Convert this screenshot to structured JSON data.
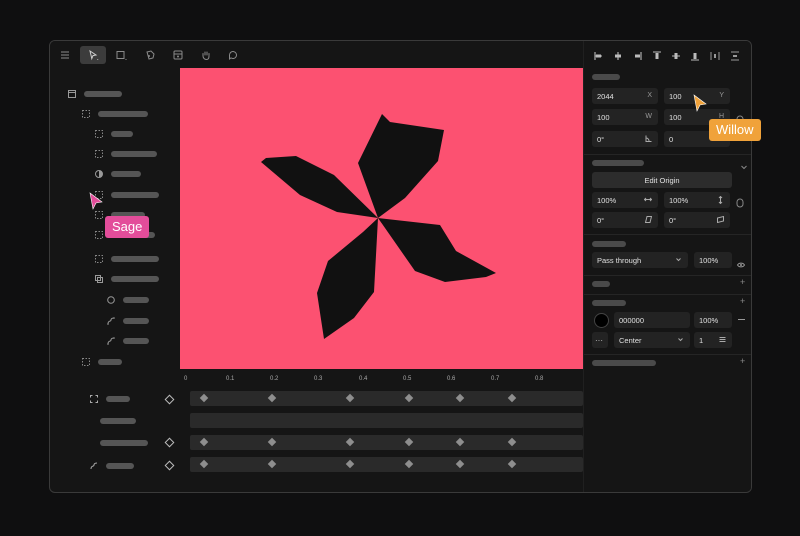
{
  "colors": {
    "canvas_bg": "#fc5171",
    "shape_fill": "#111111",
    "app_bg": "#151515",
    "field_bg": "#232323",
    "sage": "#e34d9a",
    "willow": "#f0a23a"
  },
  "toolbar": {
    "tools": [
      "menu-icon",
      "select-arrow-icon",
      "rectangle-icon",
      "pen-tool-icon",
      "frame-icon",
      "hand-icon",
      "comment-icon"
    ]
  },
  "panel": {
    "x_value": "2044",
    "x_label": "X",
    "y_value": "100",
    "y_label": "Y",
    "w_value": "100",
    "w_label": "W",
    "h_value": "100",
    "h_label": "H",
    "rotation_value": "0°",
    "corner_value": "0",
    "edit_origin_label": "Edit Origin",
    "scale_x": "100%",
    "scale_y": "100%",
    "skew_x": "0°",
    "skew_y": "0°",
    "blend_mode": "Pass through",
    "opacity": "100%",
    "fill_hex": "000000",
    "fill_opacity": "100%",
    "stroke_align": "Center",
    "stroke_width": "1"
  },
  "timeline": {
    "ruler_labels": [
      "0",
      "0.1",
      "0.2",
      "0.3",
      "0.4",
      "0.5",
      "0.6",
      "0.7",
      "0.8"
    ]
  },
  "collaborators": {
    "sage_name": "Sage",
    "willow_name": "Willow"
  }
}
